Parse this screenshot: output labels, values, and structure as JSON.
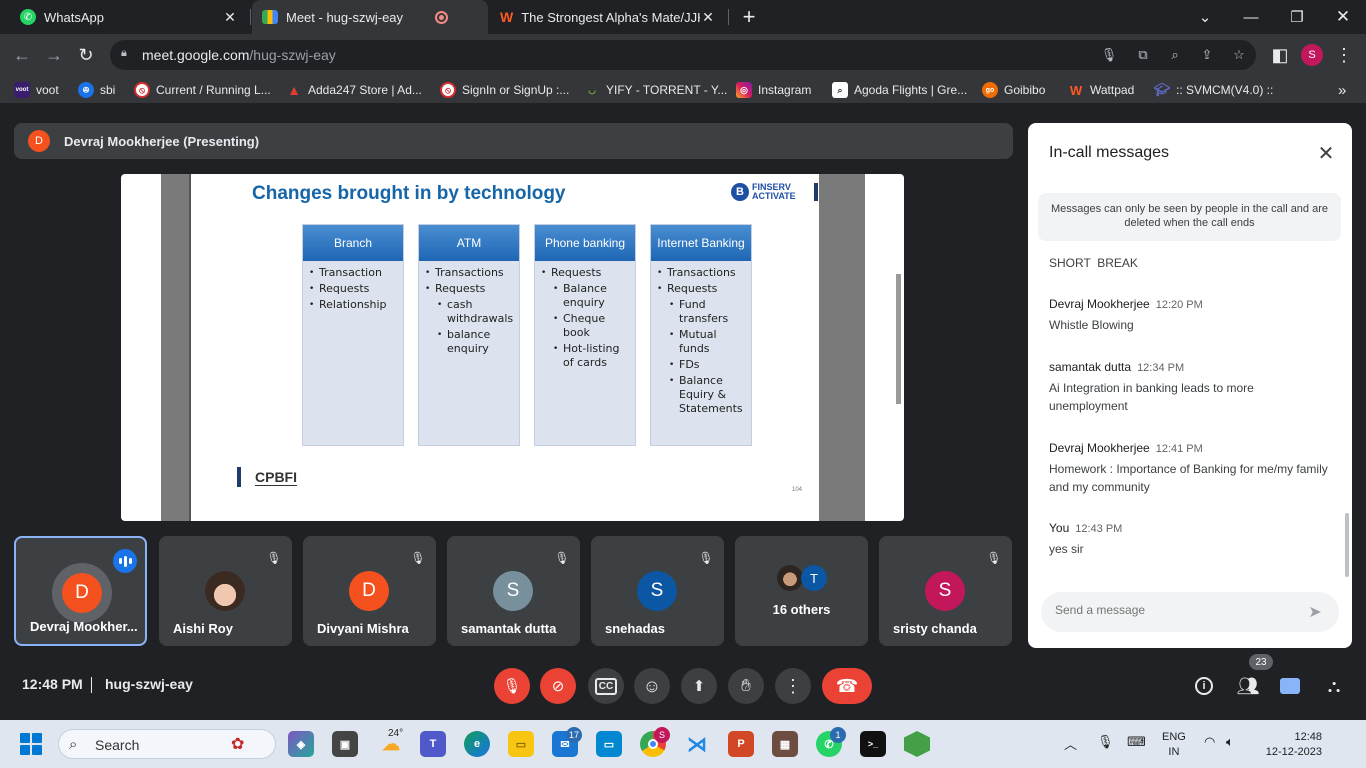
{
  "browser": {
    "tabs": [
      {
        "title": "WhatsApp",
        "icon": "whatsapp-icon"
      },
      {
        "title": "Meet - hug-szwj-eay",
        "icon": "meet-icon"
      },
      {
        "title": "The Strongest Alpha's Mate/JJK",
        "icon": "wattpad-icon"
      }
    ],
    "new_tab": "+",
    "url_domain": "meet.google.com",
    "url_path": "/hug-szwj-eay",
    "profile_initial": "S",
    "bookmarks": [
      {
        "label": "voot",
        "icon": "voot-icon"
      },
      {
        "label": "sbi",
        "icon": "sbi-icon"
      },
      {
        "label": "Current / Running L...",
        "icon": "blocked-icon"
      },
      {
        "label": "Adda247 Store | Ad...",
        "icon": "adda-icon"
      },
      {
        "label": "SignIn or SignUp :...",
        "icon": "blocked-icon"
      },
      {
        "label": "YIFY - TORRENT - Y...",
        "icon": "yify-icon"
      },
      {
        "label": "Instagram",
        "icon": "instagram-icon"
      },
      {
        "label": "Agoda Flights | Gre...",
        "icon": "agoda-icon"
      },
      {
        "label": "Goibibo",
        "icon": "goibibo-icon"
      },
      {
        "label": "Wattpad",
        "icon": "wattpad-icon"
      },
      {
        "label": ":: SVMCM(V4.0) ::",
        "icon": "svmcm-icon"
      }
    ],
    "bookmarks_more": "»"
  },
  "meet": {
    "presenter": {
      "initial": "D",
      "label": "Devraj Mookherjee (Presenting)"
    },
    "slide": {
      "title": "Changes brought in by technology",
      "logo_mark": "B",
      "logo_line1": "FINSERV",
      "logo_line2": "ACTIVATE",
      "columns": [
        {
          "header": "Branch",
          "items": [
            {
              "text": "Transaction",
              "sub": false
            },
            {
              "text": " Requests",
              "sub": false
            },
            {
              "text": "Relationship",
              "sub": false
            }
          ]
        },
        {
          "header": "ATM",
          "items": [
            {
              "text": "Transactions",
              "sub": false
            },
            {
              "text": "Requests",
              "sub": false
            },
            {
              "text": "cash withdrawals",
              "sub": true
            },
            {
              "text": "balance enquiry",
              "sub": true
            }
          ]
        },
        {
          "header": "Phone banking",
          "items": [
            {
              "text": "Requests",
              "sub": false
            },
            {
              "text": "Balance enquiry",
              "sub": true
            },
            {
              "text": " Cheque book",
              "sub": true
            },
            {
              "text": "Hot-listing of cards",
              "sub": true
            }
          ]
        },
        {
          "header": "Internet Banking",
          "items": [
            {
              "text": "Transactions",
              "sub": false
            },
            {
              "text": "Requests",
              "sub": false
            },
            {
              "text": "Fund transfers",
              "sub": true
            },
            {
              "text": "Mutual funds",
              "sub": true
            },
            {
              "text": "FDs",
              "sub": true
            },
            {
              "text": "Balance Equiry & Statements",
              "sub": true
            }
          ]
        }
      ],
      "footer": "CPBFI",
      "page_number": "104"
    },
    "participants": [
      {
        "name": "Devraj Mookher...",
        "initial": "D",
        "color": "#f4511e",
        "state": "speaking"
      },
      {
        "name": "Aishi Roy",
        "initial": "",
        "color": "#e8d3c4",
        "state": "muted",
        "photo": true
      },
      {
        "name": "Divyani Mishra",
        "initial": "D",
        "color": "#f4511e",
        "state": "muted"
      },
      {
        "name": "samantak dutta",
        "initial": "S",
        "color": "#78909c",
        "state": "muted"
      },
      {
        "name": "snehadas",
        "initial": "S",
        "color": "#0b57a4",
        "state": "muted"
      },
      {
        "name": "16 others",
        "initial": "T",
        "color": "#0b57a4",
        "state": "group"
      },
      {
        "name": "sristy chanda",
        "initial": "S",
        "color": "#c2185b",
        "state": "muted"
      }
    ],
    "chat": {
      "title": "In-call messages",
      "notice": "Messages can only be seen by people in the call and are deleted when the call ends",
      "messages": [
        {
          "sender": "",
          "time": "",
          "text": "SHORT  BREAK"
        },
        {
          "sender": "Devraj Mookherjee",
          "time": "12:20 PM",
          "text": "Whistle Blowing"
        },
        {
          "sender": "samantak dutta",
          "time": "12:34 PM",
          "text": "Ai Integration in banking leads to more unemployment"
        },
        {
          "sender": "Devraj Mookherjee",
          "time": "12:41 PM",
          "text": "Homework : Importance of Banking for me/my family and my community"
        },
        {
          "sender": "You",
          "time": "12:43 PM",
          "text": "yes sir"
        }
      ],
      "input_placeholder": "Send a message"
    },
    "bottom": {
      "clock": "12:48 PM",
      "separator": "|",
      "meeting_code": "hug-szwj-eay",
      "people_count": "23"
    }
  },
  "taskbar": {
    "search_label": "Search",
    "weather": "24°",
    "mail_badge": "17",
    "chrome_badge": "S",
    "whatsapp_badge": "1",
    "lang_line1": "ENG",
    "lang_line2": "IN",
    "time": "12:48",
    "date": "12-12-2023"
  }
}
